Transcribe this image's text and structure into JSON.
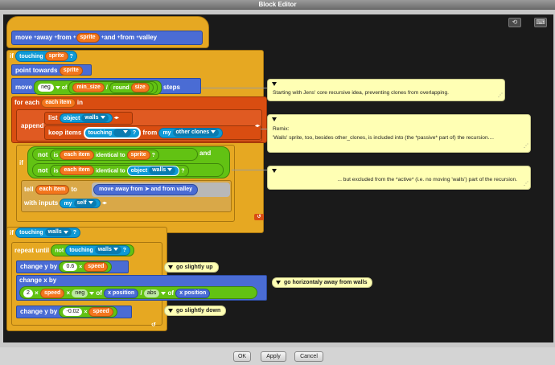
{
  "window": {
    "title": "Block Editor"
  },
  "toolbar": {
    "undo_icon": "undo-arrow-icon",
    "keyboard_icon": "keyboard-icon"
  },
  "hat": {
    "words": [
      "move",
      "away",
      "from",
      "sprite",
      "and",
      "from",
      "valley"
    ]
  },
  "if1": {
    "label": "if",
    "touching": "touching",
    "target": "sprite",
    "q": "?"
  },
  "point": {
    "label": "point towards",
    "target": "sprite"
  },
  "move": {
    "label": "move",
    "neg": "neg",
    "of": "of",
    "min_size": "min_size",
    "div": "/",
    "round": "round",
    "size": "size",
    "steps": "steps"
  },
  "foreach": {
    "label": "for each",
    "item": "each item",
    "in": "in"
  },
  "append": {
    "label": "append",
    "list": "list",
    "object": "object",
    "walls": "walls",
    "keep": "keep items",
    "touching": "touching",
    "q": "?",
    "from": "from",
    "my": "my",
    "other_clones": "other clones"
  },
  "if2": {
    "label": "if",
    "not": "not",
    "is": "is",
    "item": "each item",
    "identical": "identical to",
    "sprite": "sprite",
    "q": "?",
    "and": "and",
    "object": "object",
    "walls": "walls"
  },
  "tell": {
    "label": "tell",
    "item": "each item",
    "to": "to",
    "ring": "move away from",
    "and_from": "and from valley",
    "with_inputs": "with inputs",
    "my": "my",
    "self": "self"
  },
  "if3": {
    "label": "if",
    "touching": "touching",
    "walls": "walls",
    "q": "?"
  },
  "repeat": {
    "label": "repeat until",
    "not": "not",
    "touching": "touching",
    "walls": "walls",
    "q": "?"
  },
  "cy1": {
    "label": "change y by",
    "val": "0.6",
    "times": "×",
    "speed": "speed"
  },
  "cx": {
    "label": "change x by",
    "two": "2",
    "times": "×",
    "speed": "speed",
    "neg": "neg",
    "of": "of",
    "xpos": "x position",
    "div": "/",
    "abs": "abs",
    "of2": "of",
    "xpos2": "x position"
  },
  "cy2": {
    "label": "change y by",
    "val": "-0.02",
    "times": "×",
    "speed": "speed"
  },
  "notes": [
    {
      "text": "Starting with Jens' core recursive idea, preventing clones from overlapping."
    },
    {
      "line1": "Remix:",
      "line2": "'Walls' sprite, too, besides other_clones, is included into (the *passive* part of) the recursion...."
    },
    {
      "text": "... but excluded from the *active* (i.e. no moving 'walls') part of the recursion."
    }
  ],
  "comments": [
    "go slightly up",
    "go horizontaly away from walls",
    "go slightly down"
  ],
  "buttons": {
    "ok": "OK",
    "apply": "Apply",
    "cancel": "Cancel"
  }
}
